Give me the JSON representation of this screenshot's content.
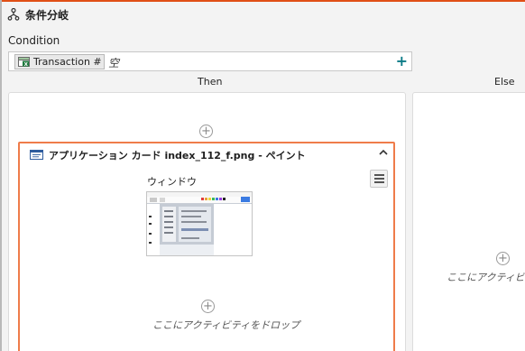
{
  "header": {
    "title": "条件分岐",
    "icon": "flow-branch-icon"
  },
  "condition": {
    "label": "Condition",
    "variable_chip": "Transaction #",
    "variable_icon": "excel-column-icon",
    "empty_value": "空",
    "add_icon": "plus-icon"
  },
  "branches": {
    "then_label": "Then",
    "else_label": "Else"
  },
  "card": {
    "title": "アプリケーション カード index_112_f.png - ペイント",
    "window_label": "ウィンドウ",
    "icon": "application-window-icon",
    "border_color": "#ef7c4a"
  },
  "drop_zone": {
    "text": "ここにアクティビティをドロップ",
    "else_text": "ここにアクティビティ"
  },
  "colors": {
    "accent": "#e04f16",
    "add_icon": "#0b7a86"
  }
}
